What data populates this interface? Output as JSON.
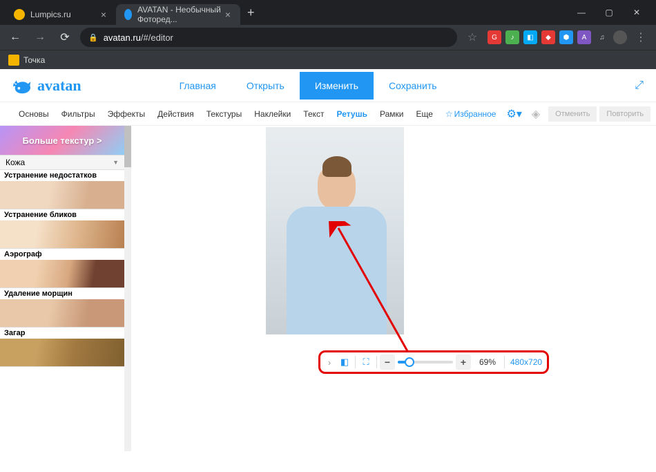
{
  "tabs": [
    {
      "title": "Lumpics.ru",
      "favicon_color": "#f4b400"
    },
    {
      "title": "AVATAN - Необычный Фоторед...",
      "favicon_color": "#2196f3"
    }
  ],
  "url": {
    "host": "avatan.ru",
    "path": "/#/editor"
  },
  "bookmark": {
    "label": "Точка"
  },
  "logo_text": "avatan",
  "main_nav": {
    "home": "Главная",
    "open": "Открыть",
    "edit": "Изменить",
    "save": "Сохранить"
  },
  "toolbar": {
    "basics": "Основы",
    "filters": "Фильтры",
    "effects": "Эффекты",
    "actions": "Действия",
    "textures": "Текстуры",
    "stickers": "Наклейки",
    "text": "Текст",
    "retouch": "Ретушь",
    "frames": "Рамки",
    "more": "Еще",
    "favorites": "Избранное",
    "undo": "Отменить",
    "redo": "Повторить"
  },
  "sidebar": {
    "promo": "Больше текстур >",
    "category": "Кожа",
    "items": [
      "Устранение недостатков",
      "Устранение бликов",
      "Аэрограф",
      "Удаление морщин",
      "Загар"
    ]
  },
  "zoom": {
    "percent": "69%",
    "dimensions": "480x720"
  }
}
